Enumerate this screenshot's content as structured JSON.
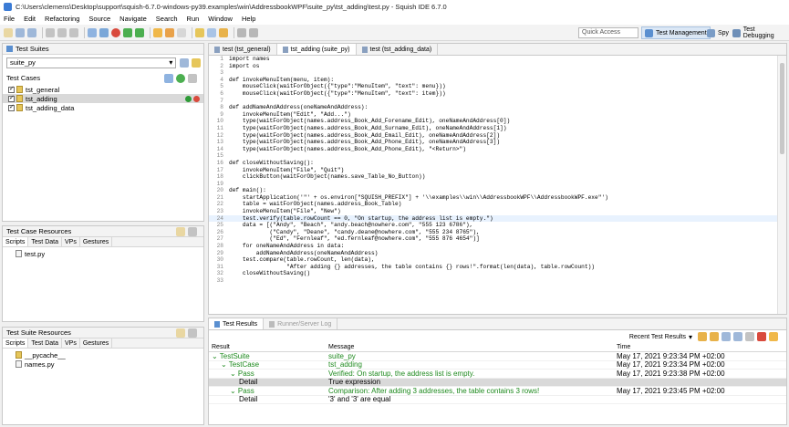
{
  "window": {
    "title": "C:\\Users\\clemens\\Desktop\\support\\squish-6.7.0-windows-py39.examples\\win\\AddressbookWPF\\suite_py\\tst_adding\\test.py - Squish IDE 6.7.0"
  },
  "menu": [
    "File",
    "Edit",
    "Refactoring",
    "Source",
    "Navigate",
    "Search",
    "Run",
    "Window",
    "Help"
  ],
  "toolbar": {
    "quick_access": "Quick Access",
    "perspectives": [
      "Test Management",
      "Spy",
      "Test Debugging"
    ]
  },
  "test_suites": {
    "title": "Test Suites",
    "suite": "suite_py",
    "cases_label": "Test Cases",
    "cases": [
      "tst_general",
      "tst_adding",
      "tst_adding_data"
    ]
  },
  "case_resources": {
    "title": "Test Case Resources",
    "tabs": [
      "Scripts",
      "Test Data",
      "VPs",
      "Gestures"
    ],
    "files": [
      "test.py"
    ]
  },
  "suite_resources": {
    "title": "Test Suite Resources",
    "tabs": [
      "Scripts",
      "Test Data",
      "VPs",
      "Gestures"
    ],
    "files": [
      "__pycache__",
      "names.py"
    ]
  },
  "editor": {
    "tabs": [
      "test (tst_general)",
      "tst_adding (suite_py)",
      "test (tst_adding_data)"
    ],
    "lines": [
      "import names",
      "import os",
      "",
      "def invokeMenuItem(menu, item):",
      "    mouseClick(waitForObject({\"type\":\"MenuItem\", \"text\": menu}))",
      "    mouseClick(waitForObject({\"type\":\"MenuItem\", \"text\": item}))",
      "",
      "def addNameAndAddress(oneNameAndAddress):",
      "    invokeMenuItem(\"Edit\", \"Add...\")",
      "    type(waitForObject(names.address_Book_Add_Forename_Edit), oneNameAndAddress[0])",
      "    type(waitForObject(names.address_Book_Add_Surname_Edit), oneNameAndAddress[1])",
      "    type(waitForObject(names.address_Book_Add_Email_Edit), oneNameAndAddress[2])",
      "    type(waitForObject(names.address_Book_Add_Phone_Edit), oneNameAndAddress[3])",
      "    type(waitForObject(names.address_Book_Add_Phone_Edit), \"<Return>\")",
      "",
      "def closeWithoutSaving():",
      "    invokeMenuItem(\"File\", \"Quit\")",
      "    clickButton(waitForObject(names.save_Table_No_Button))",
      "",
      "def main():",
      "    startApplication('\"' + os.environ[\"SQUISH_PREFIX\"] + '\\\\examples\\\\win\\\\AddressbookWPF\\\\AddressbookWPF.exe\"')",
      "    table = waitForObject(names.address_Book_Table)",
      "    invokeMenuItem(\"File\", \"New\")",
      "    test.verify(table.rowCount == 0, \"On startup, the address list is empty.\")",
      "    data = [(\"Andy\", \"Beach\", \"andy.beach@nowhere.com\", \"555 123 6786\"),",
      "            (\"Candy\", \"Deane\", \"candy.deane@nowhere.com\", \"555 234 8765\"),",
      "            (\"Ed\", \"Fernleaf\", \"ed.fernleaf@nowhere.com\", \"555 876 4654\")]",
      "    for oneNameAndAddress in data:",
      "        addNameAndAddress(oneNameAndAddress)",
      "    test.compare(table.rowCount, len(data),",
      "                 \"After adding {} addresses, the table contains {} rows!\".format(len(data), table.rowCount))",
      "    closeWithoutSaving()",
      ""
    ]
  },
  "results": {
    "tabs": [
      "Test Results",
      "Runner/Server Log"
    ],
    "filter": "Recent Test Results",
    "columns": [
      "Result",
      "Message",
      "Time"
    ],
    "rows": [
      {
        "result": "TestSuite",
        "message": "suite_py",
        "time": "May 17, 2021 9:23:34 PM +02:00",
        "indent": 0
      },
      {
        "result": "TestCase",
        "message": "tst_adding",
        "time": "May 17, 2021 9:23:34 PM +02:00",
        "indent": 1
      },
      {
        "result": "Pass",
        "message": "Verified: On startup, the address list is empty.",
        "time": "May 17, 2021 9:23:38 PM +02:00",
        "indent": 2
      },
      {
        "result": "Detail",
        "message": "True expression",
        "time": "",
        "indent": 3
      },
      {
        "result": "Pass",
        "message": "Comparison: After adding 3 addresses, the table contains 3 rows!",
        "time": "May 17, 2021 9:23:45 PM +02:00",
        "indent": 2
      },
      {
        "result": "Detail",
        "message": "'3' and '3' are equal",
        "time": "",
        "indent": 3
      }
    ]
  }
}
